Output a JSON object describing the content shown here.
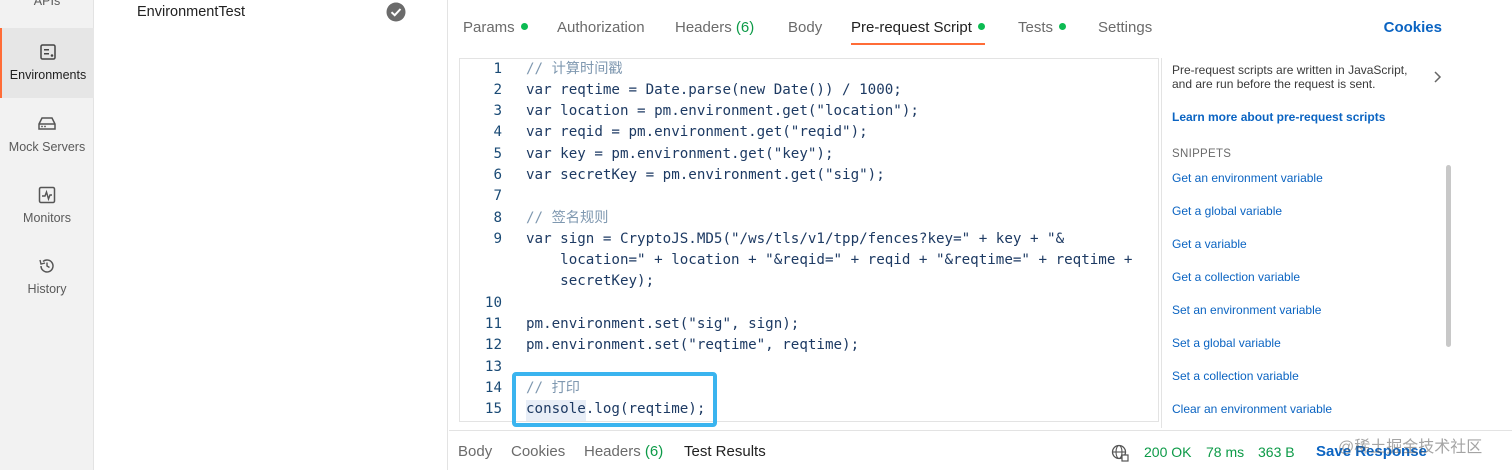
{
  "rail": {
    "apis_label": "APIs",
    "environments_label": "Environments",
    "mock_servers_label": "Mock Servers",
    "monitors_label": "Monitors",
    "history_label": "History"
  },
  "env_list": {
    "item_name": "EnvironmentTest"
  },
  "tabs": {
    "params": "Params",
    "authorization": "Authorization",
    "headers": "Headers",
    "headers_count": "(6)",
    "body": "Body",
    "pre_request": "Pre-request Script",
    "tests": "Tests",
    "settings": "Settings",
    "cookies": "Cookies"
  },
  "editor": {
    "lines": [
      {
        "n": "1",
        "text": "// 计算时间戳"
      },
      {
        "n": "2",
        "text": "var reqtime = Date.parse(new Date()) / 1000;"
      },
      {
        "n": "3",
        "text": "var location = pm.environment.get(\"location\");"
      },
      {
        "n": "4",
        "text": "var reqid = pm.environment.get(\"reqid\");"
      },
      {
        "n": "5",
        "text": "var key = pm.environment.get(\"key\");"
      },
      {
        "n": "6",
        "text": "var secretKey = pm.environment.get(\"sig\");"
      },
      {
        "n": "7",
        "text": ""
      },
      {
        "n": "8",
        "text": "// 签名规则"
      },
      {
        "n": "9",
        "text": "var sign = CryptoJS.MD5(\"/ws/tls/v1/tpp/fences?key=\" + key + \"&"
      },
      {
        "n": "",
        "text": "    location=\" + location + \"&reqid=\" + reqid + \"&reqtime=\" + reqtime +"
      },
      {
        "n": "",
        "text": "    secretKey);"
      },
      {
        "n": "10",
        "text": ""
      },
      {
        "n": "11",
        "text": "pm.environment.set(\"sig\", sign);"
      },
      {
        "n": "12",
        "text": "pm.environment.set(\"reqtime\", reqtime);"
      },
      {
        "n": "13",
        "text": ""
      },
      {
        "n": "14",
        "text": "// 打印"
      },
      {
        "n": "15",
        "text": "console.log(reqtime);"
      }
    ]
  },
  "side": {
    "description": "Pre-request scripts are written in JavaScript, and are run before the request is sent.",
    "learn_more": "Learn more about pre-request scripts",
    "snippets_heading": "SNIPPETS",
    "snippets": [
      "Get an environment variable",
      "Get a global variable",
      "Get a variable",
      "Get a collection variable",
      "Set an environment variable",
      "Set a global variable",
      "Set a collection variable",
      "Clear an environment variable"
    ]
  },
  "response": {
    "body": "Body",
    "cookies": "Cookies",
    "headers": "Headers",
    "headers_count": "(6)",
    "test_results": "Test Results",
    "status": "200 OK",
    "time": "78 ms",
    "size": "363 B",
    "save": "Save Response",
    "watermark": "@稀土掘金技术社区"
  },
  "colors": {
    "accent": "#ff6c37",
    "link": "#0b64c2",
    "success": "#0cbb52",
    "highlight": "#3ab4ef"
  }
}
